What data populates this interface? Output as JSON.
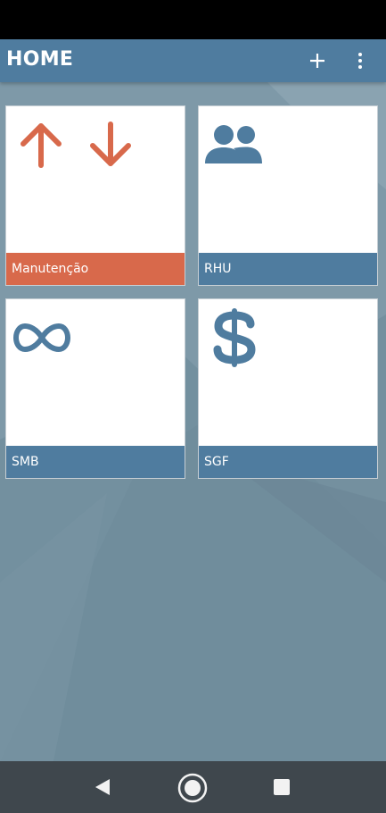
{
  "app_bar": {
    "title": "HOME",
    "background": "#4f7c9f",
    "actions": [
      "plus-icon",
      "more-vert-icon"
    ]
  },
  "tiles": [
    {
      "label": "Manutenção",
      "icon": "arrows-up-down-icon",
      "accent": "#d8694b"
    },
    {
      "label": "RHU",
      "icon": "people-icon",
      "accent": "#4f7c9f"
    },
    {
      "label": "SMB",
      "icon": "infinity-icon",
      "accent": "#4f7c9f"
    },
    {
      "label": "SGF",
      "icon": "dollar-icon",
      "accent": "#4f7c9f"
    }
  ],
  "nav_bar": {
    "buttons": [
      "back-icon",
      "home-icon",
      "recents-icon"
    ],
    "background": "#3f474d"
  },
  "colors": {
    "content_background": "#74909f",
    "tile_background": "#ffffff"
  }
}
